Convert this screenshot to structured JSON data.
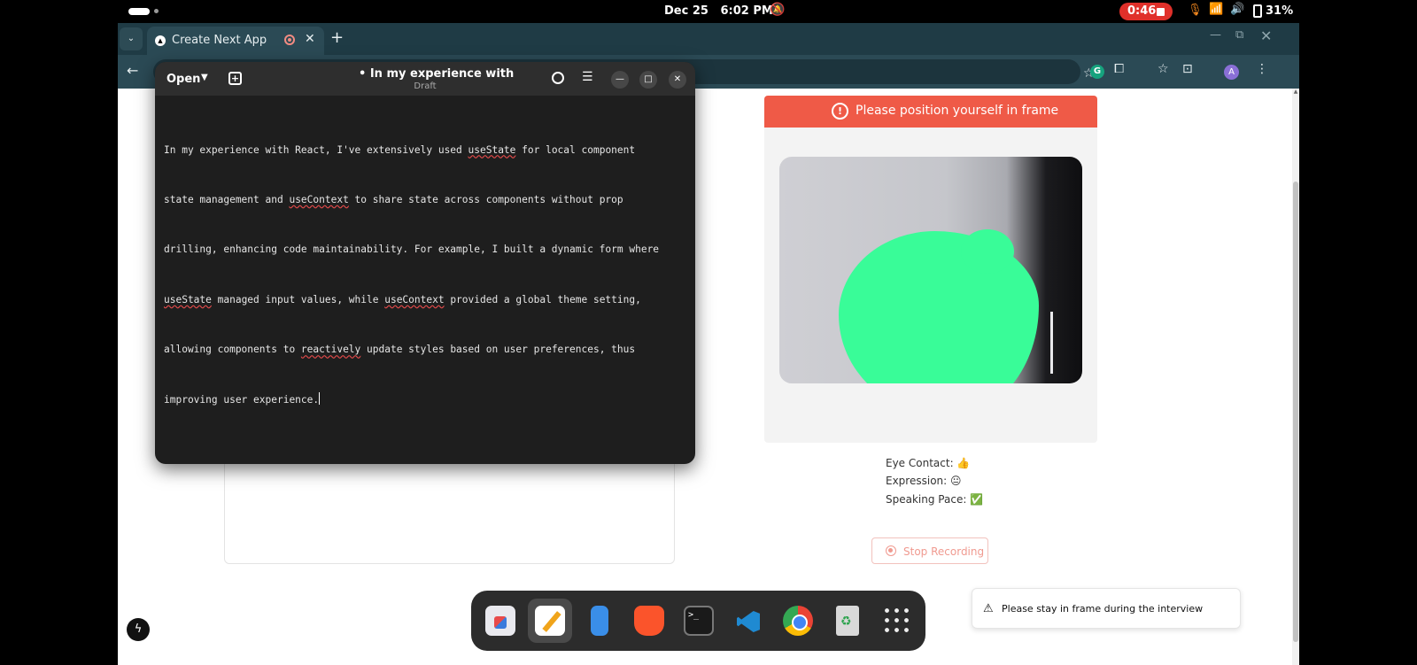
{
  "system_bar": {
    "date": "Dec 25",
    "time": "6:02 PM",
    "recording_time": "0:46",
    "battery": "31%"
  },
  "browser": {
    "tab_title": "Create Next App",
    "new_tab_label": "+",
    "profile_initial": "A"
  },
  "editor": {
    "open_label": "Open",
    "title": "• In my experience with",
    "subtitle": "Draft",
    "lines": [
      [
        "In my experience with React, I've extensively used ",
        "useState",
        " for local component"
      ],
      [
        "state management and ",
        "useContext",
        " to share state across components without prop"
      ],
      [
        "drilling, enhancing code maintainability. For example, I built a dynamic form where"
      ],
      [
        "",
        "useState",
        " managed input values, while ",
        "useContext",
        " provided a global theme setting,"
      ],
      [
        "allowing components to ",
        "reactively",
        " update styles based on user preferences, thus"
      ],
      [
        "improving user experience."
      ]
    ]
  },
  "interview": {
    "banner": "Please position yourself in frame",
    "metrics": {
      "eye_contact": "Eye Contact: 👍",
      "expression": "Expression: 😐",
      "speaking_pace": "Speaking Pace: ✅"
    },
    "stop_button": "Stop Recording",
    "toast": "Please stay in frame during the interview"
  },
  "colors": {
    "banner": "#ef5a47",
    "browser_chrome": "#2b4a55",
    "editor_bg": "#1e1e1e",
    "face_mask": "#39fc98"
  }
}
